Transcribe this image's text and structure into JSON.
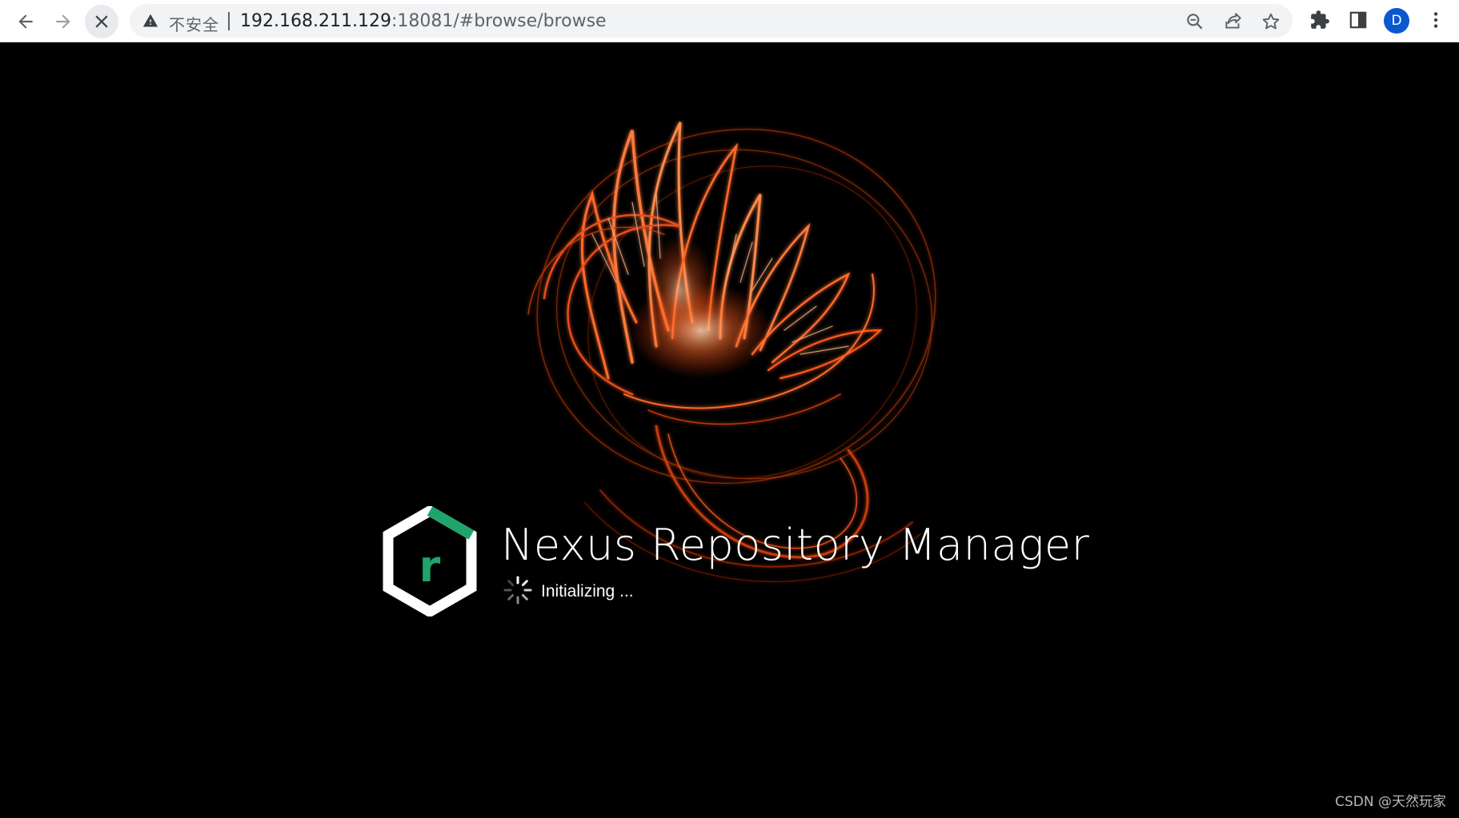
{
  "browser": {
    "security_label": "不安全",
    "url_host": "192.168.211.129",
    "url_rest": ":18081/#browse/browse",
    "profile_initial": "D"
  },
  "loading": {
    "product_name": "Nexus Repository Manager",
    "status": "Initializing ..."
  },
  "watermark": "CSDN @天然玩家",
  "colors": {
    "logo_green": "#1fa46b",
    "fire_orange": "#ff5a1f",
    "avatar_blue": "#0b57d0"
  }
}
